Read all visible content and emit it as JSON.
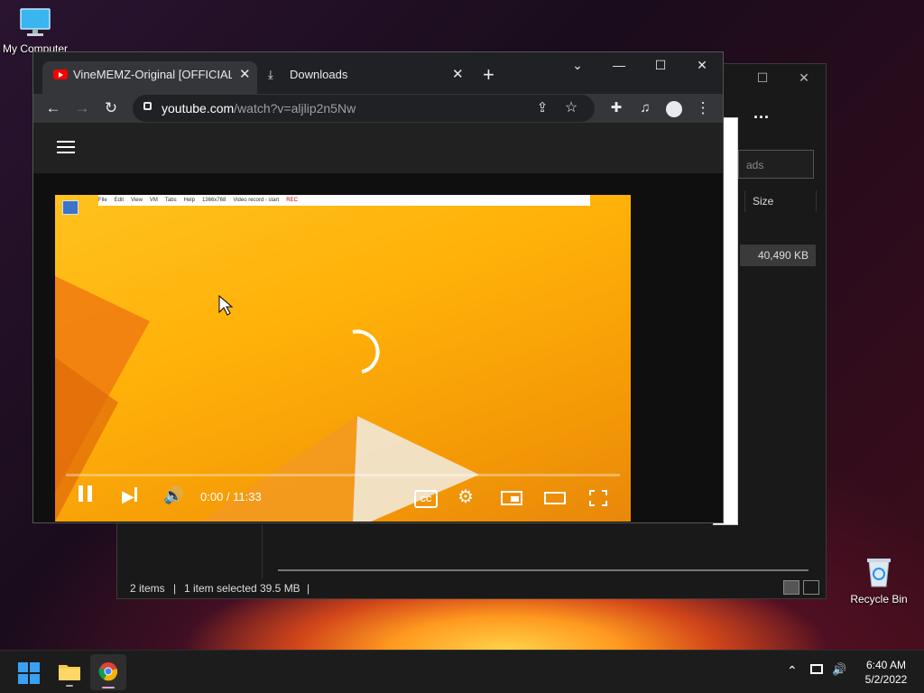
{
  "desktop": {
    "icons": [
      {
        "label": "My Computer"
      },
      {
        "label": "Recycle Bin"
      }
    ]
  },
  "explorer": {
    "more_label": "...",
    "search_placeholder": "ads",
    "column_size": "Size",
    "selected_size_value": "40,490 KB",
    "status": {
      "items": "2 items",
      "selected": "1 item selected",
      "size": "39.5 MB"
    }
  },
  "chrome": {
    "tabs": [
      {
        "title": "VineMEMZ-Original [OFFICIAL] F",
        "active": true,
        "icon": "youtube-icon"
      },
      {
        "title": "Downloads",
        "active": false,
        "icon": "download-icon"
      }
    ],
    "new_tab": "+",
    "url": {
      "host": "youtube.com",
      "path": "/watch?v=aljlip2n5Nw"
    },
    "video": {
      "inner_menu": [
        "File",
        "Edit",
        "View",
        "VM",
        "Tabs",
        "Help"
      ],
      "inner_resolution": "1366x768",
      "inner_record": "Video record - start",
      "inner_rec_badge": "REC",
      "time": "0:00 / 11:33",
      "cc_label": "CC",
      "progress": 0
    }
  },
  "taskbar": {
    "clock_time": "6:40 AM",
    "clock_date": "5/2/2022"
  },
  "colors": {
    "chrome_bg": "#202124",
    "toolbar_bg": "#35363a",
    "youtube_red": "#ff0000",
    "video_orange": "#ffb109"
  }
}
